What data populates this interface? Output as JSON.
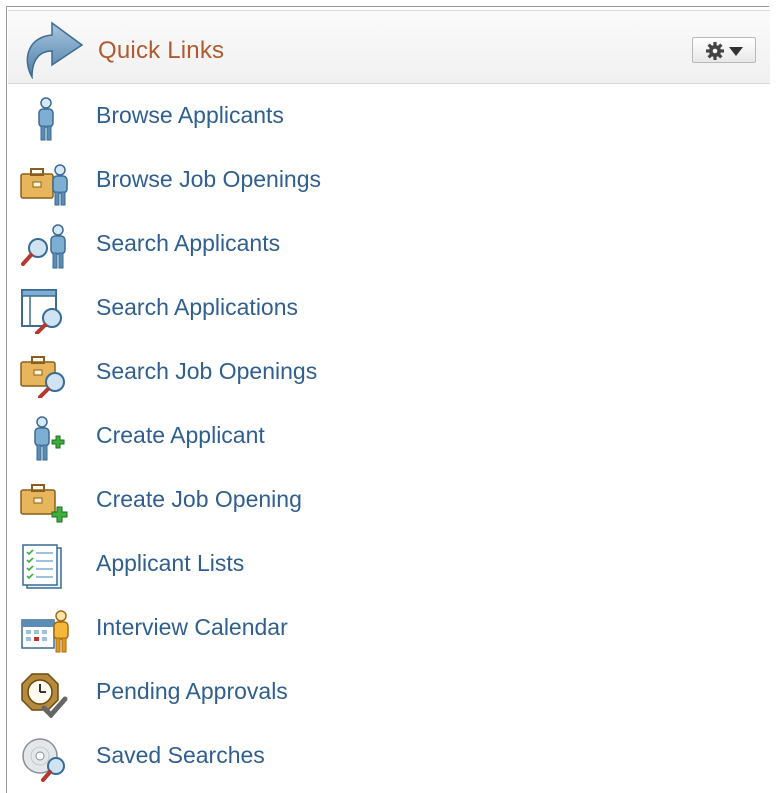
{
  "header": {
    "title": "Quick Links",
    "arrow_icon": "curved-arrow-icon",
    "options_icon": "gear-icon"
  },
  "links": [
    {
      "label": "Browse Applicants",
      "icon": "applicant-person-icon"
    },
    {
      "label": "Browse Job Openings",
      "icon": "briefcase-person-icon"
    },
    {
      "label": "Search Applicants",
      "icon": "search-people-icon"
    },
    {
      "label": "Search Applications",
      "icon": "search-window-icon"
    },
    {
      "label": "Search Job Openings",
      "icon": "search-briefcase-icon"
    },
    {
      "label": "Create Applicant",
      "icon": "add-person-icon"
    },
    {
      "label": "Create Job Opening",
      "icon": "add-briefcase-icon"
    },
    {
      "label": "Applicant Lists",
      "icon": "checklist-icon"
    },
    {
      "label": "Interview Calendar",
      "icon": "calendar-person-icon"
    },
    {
      "label": "Pending Approvals",
      "icon": "clock-check-icon"
    },
    {
      "label": "Saved Searches",
      "icon": "disc-search-icon"
    }
  ],
  "colors": {
    "title": "#b05a2e",
    "link": "#2f5f8f"
  }
}
